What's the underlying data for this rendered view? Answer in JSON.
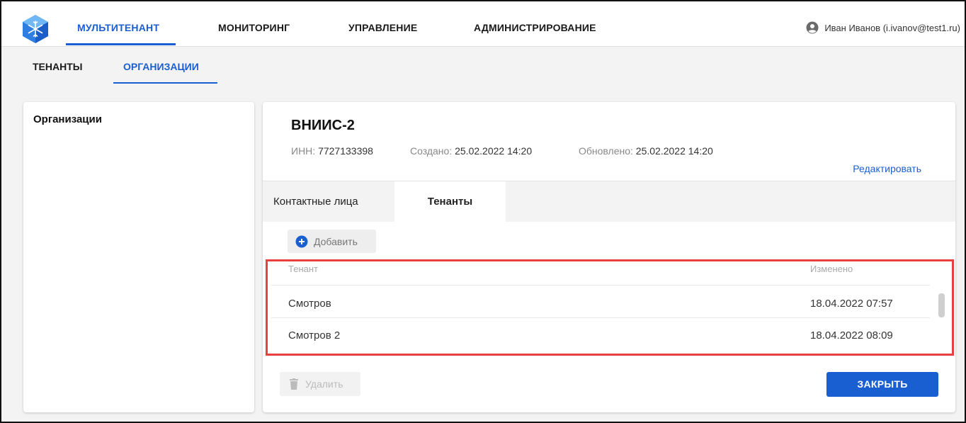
{
  "colors": {
    "accent": "#1a5fd1",
    "highlight": "#e8403f"
  },
  "topnav": {
    "items": [
      "МУЛЬТИТЕНАНТ",
      "МОНИТОРИНГ",
      "УПРАВЛЕНИЕ",
      "АДМИНИСТРИРОВАНИЕ"
    ],
    "active": "МУЛЬТИТЕНАНТ",
    "user_label": "Иван Иванов (i.ivanov@test1.ru)",
    "user_icon": "account-circle-icon",
    "logo_icon": "snowflake-hexagon-logo"
  },
  "subtabs": {
    "items": [
      "ТЕНАНТЫ",
      "ОРГАНИЗАЦИИ"
    ],
    "active": "ОРГАНИЗАЦИИ"
  },
  "left_panel": {
    "title": "Организации"
  },
  "org": {
    "name": "ВНИИС-2",
    "inn_label": "ИНН:",
    "inn_value": "7727133398",
    "created_label": "Создано:",
    "created_value": "25.02.2022 14:20",
    "updated_label": "Обновлено:",
    "updated_value": "25.02.2022 14:20",
    "edit_label": "Редактировать"
  },
  "detail_tabs": {
    "items": [
      "Контактные лица",
      "Тенанты"
    ],
    "active": "Тенанты"
  },
  "toolbar": {
    "add_label": "Добавить",
    "add_icon": "plus-circle-icon"
  },
  "table": {
    "columns": [
      "Тенант",
      "Изменено"
    ],
    "rows": [
      {
        "tenant": "Смотров",
        "modified": "18.04.2022 07:57"
      },
      {
        "tenant": "Смотров 2",
        "modified": "18.04.2022 08:09"
      }
    ]
  },
  "footer": {
    "delete_label": "Удалить",
    "delete_icon": "trash-icon",
    "close_label": "ЗАКРЫТЬ"
  }
}
